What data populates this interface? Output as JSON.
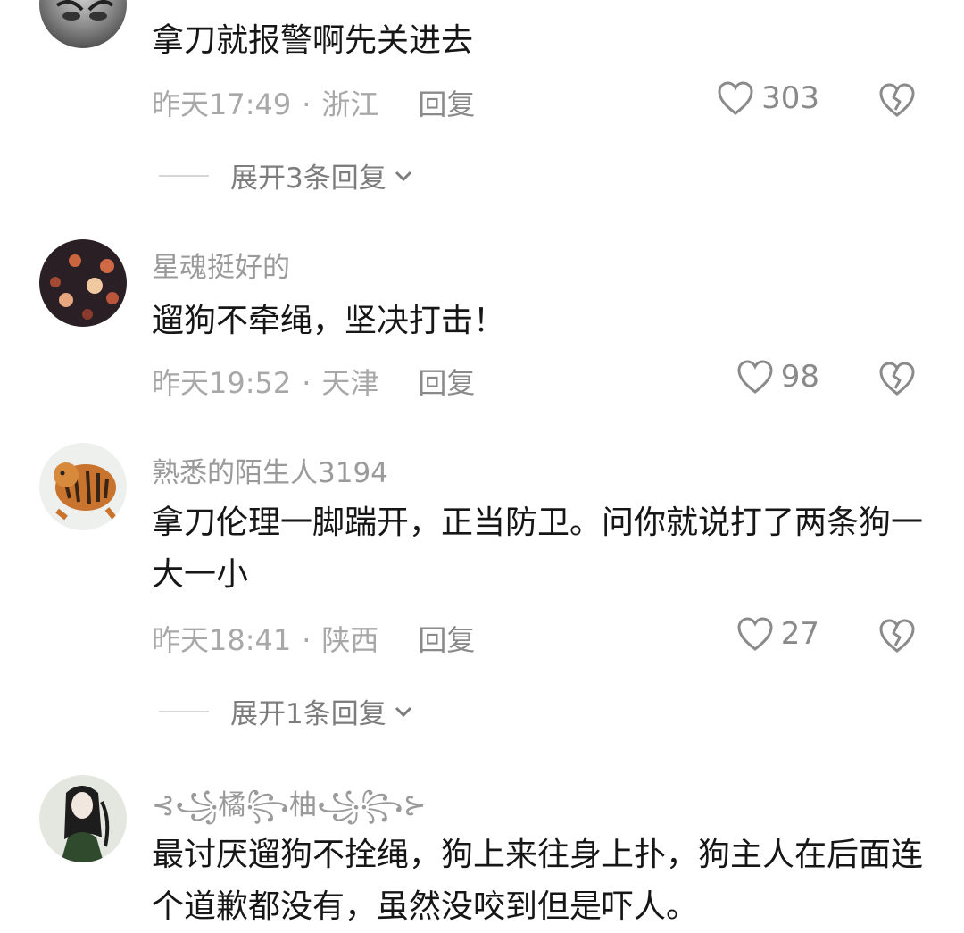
{
  "comments": [
    {
      "username": "",
      "text": "拿刀就报警啊先关进去",
      "time": "昨天17:49",
      "location": "浙江",
      "reply_label": "回复",
      "likes": "303",
      "expand_label": "展开3条回复"
    },
    {
      "username": "星魂挺好的",
      "text": "遛狗不牵绳，坚决打击！",
      "time": "昨天19:52",
      "location": "天津",
      "reply_label": "回复",
      "likes": "98"
    },
    {
      "username": "熟悉的陌生人3194",
      "text": "拿刀伦理一脚踹开，正当防卫。问你就说打了两条狗一大一小",
      "time": "昨天18:41",
      "location": "陕西",
      "reply_label": "回复",
      "likes": "27",
      "expand_label": "展开1条回复"
    },
    {
      "username": "⊰꧁橘꧂柚꧁꧂⊱",
      "text": "最讨厌遛狗不拴绳，狗上来往身上扑，狗主人在后面连个道歉都没有，虽然没咬到但是吓人。"
    }
  ],
  "meta_separator": "·",
  "icons": {
    "like": "heart-outline-icon",
    "dislike": "broken-heart-icon",
    "expand": "chevron-down-icon"
  },
  "colors": {
    "text": "#161616",
    "muted": "#a8a8a8",
    "icon": "#8a8a8a"
  }
}
